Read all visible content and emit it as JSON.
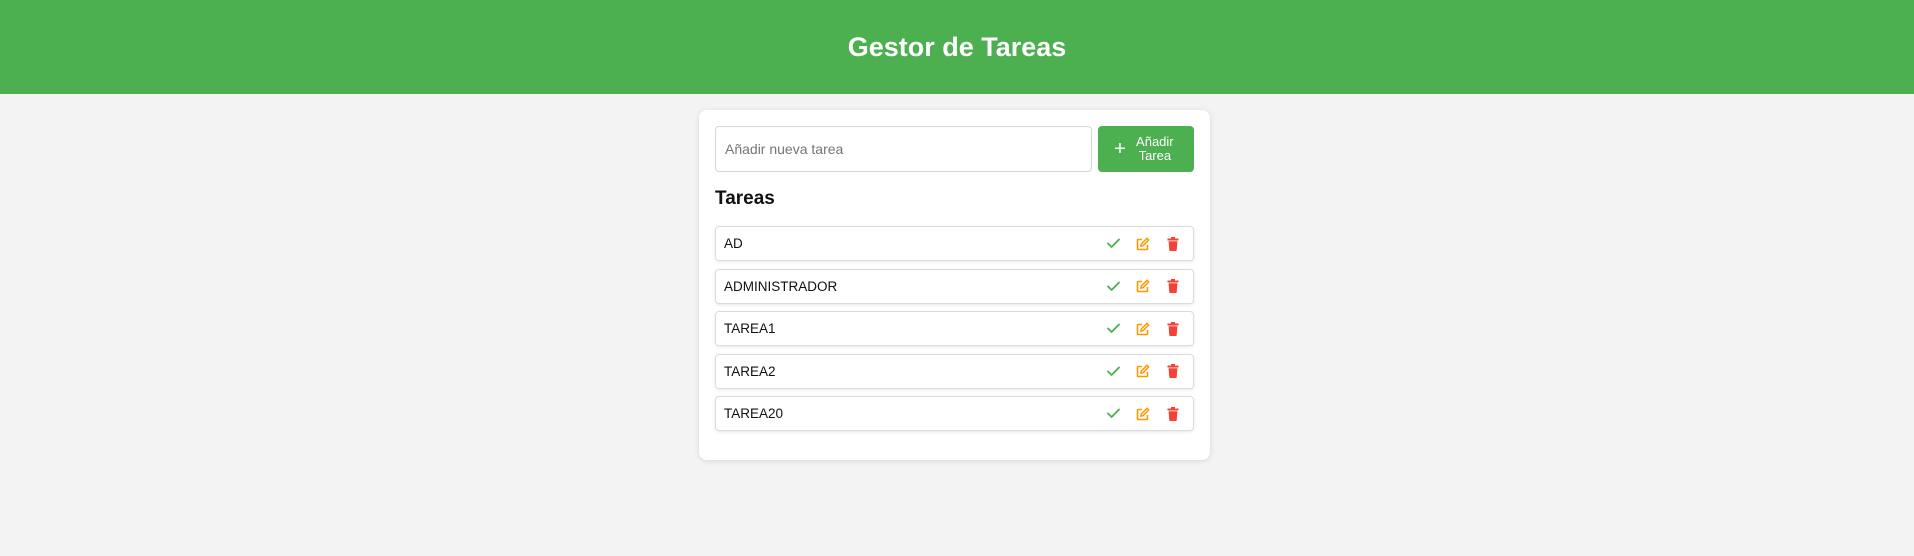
{
  "header": {
    "title": "Gestor de Tareas"
  },
  "add_form": {
    "input_placeholder": "Añadir nueva tarea",
    "input_value": "",
    "button_icon": "plus-icon",
    "button_label": "Añadir Tarea"
  },
  "tasks_section": {
    "title": "Tareas",
    "items": [
      {
        "label": "AD"
      },
      {
        "label": "ADMINISTRADOR"
      },
      {
        "label": "TAREA1"
      },
      {
        "label": "TAREA2"
      },
      {
        "label": "TAREA20"
      }
    ],
    "actions": [
      "check-icon",
      "edit-icon",
      "trash-icon"
    ]
  },
  "colors": {
    "primary_green": "#4caf50",
    "background": "#f3f3f3",
    "check": "#4caf50",
    "edit": "#ff9800",
    "delete": "#f44336"
  }
}
